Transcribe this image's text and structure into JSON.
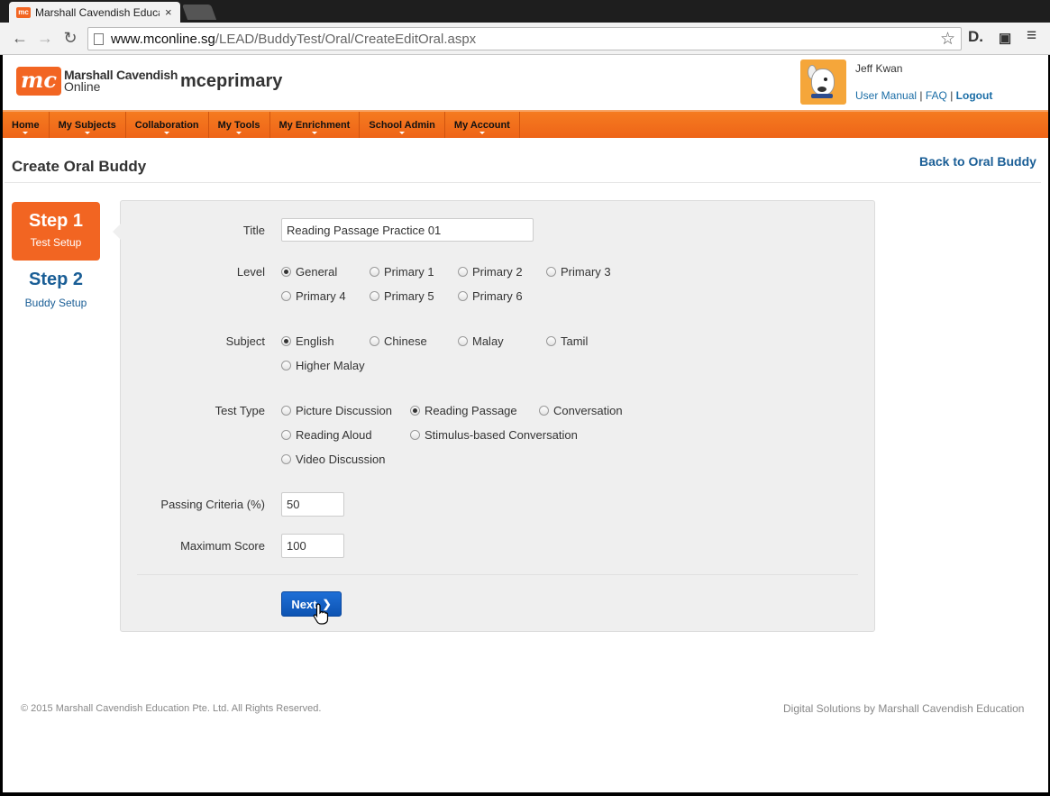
{
  "browser": {
    "tab_title": "Marshall Cavendish Educa",
    "tab_close": "×",
    "favicon_text": "mc",
    "url_host": "www.mconline.sg",
    "url_path": "/LEAD/BuddyTest/Oral/CreateEditOral.aspx",
    "back": "←",
    "forward": "→",
    "reload": "↻",
    "star": "☆",
    "ext_d": "D.",
    "ext_menu": "≡"
  },
  "header": {
    "logo_mark": "mc",
    "logo_line1": "Marshall Cavendish",
    "logo_line2": "Online",
    "site_name": "mceprimary",
    "user_name": "Jeff Kwan",
    "user_manual": "User Manual",
    "faq": "FAQ",
    "logout": "Logout",
    "sep": "|"
  },
  "nav": {
    "items": [
      "Home",
      "My Subjects",
      "Collaboration",
      "My Tools",
      "My Enrichment",
      "School Admin",
      "My Account"
    ]
  },
  "page": {
    "title": "Create Oral Buddy",
    "back_link": "Back to Oral Buddy"
  },
  "steps": {
    "step1_num": "Step 1",
    "step1_label": "Test Setup",
    "step2_num": "Step 2",
    "step2_label": "Buddy Setup"
  },
  "form": {
    "title_label": "Title",
    "title_value": "Reading Passage Practice 01",
    "level_label": "Level",
    "levels": [
      "General",
      "Primary 1",
      "Primary 2",
      "Primary 3",
      "Primary 4",
      "Primary 5",
      "Primary 6"
    ],
    "level_selected": "General",
    "subject_label": "Subject",
    "subjects": [
      "English",
      "Chinese",
      "Malay",
      "Tamil",
      "Higher Malay"
    ],
    "subject_selected": "English",
    "test_type_label": "Test Type",
    "test_types": [
      "Picture Discussion",
      "Reading Passage",
      "Conversation",
      "Reading Aloud",
      "Stimulus-based Conversation",
      "Video Discussion"
    ],
    "test_type_selected": "Reading Passage",
    "passing_label": "Passing Criteria (%)",
    "passing_value": "50",
    "max_score_label": "Maximum Score",
    "max_score_value": "100",
    "next_label": "Next",
    "next_chevron": "❯"
  },
  "footer": {
    "copyright": "© 2015 Marshall Cavendish Education Pte. Ltd. All Rights Reserved.",
    "credit": "Digital Solutions by Marshall Cavendish Education"
  },
  "colors": {
    "brand_orange": "#f26522",
    "link_blue": "#1a5e96",
    "button_blue": "#1565c9"
  }
}
